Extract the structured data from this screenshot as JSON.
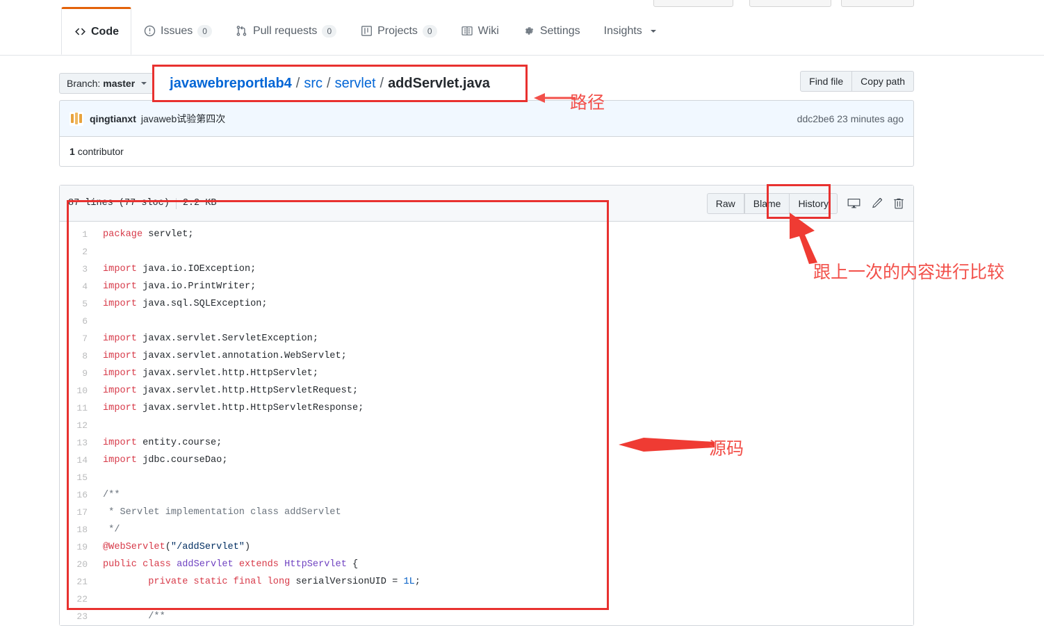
{
  "nav": {
    "tabs": [
      {
        "label": "Code",
        "icon": "code-icon",
        "count": null,
        "active": true
      },
      {
        "label": "Issues",
        "icon": "issue-icon",
        "count": "0",
        "active": false
      },
      {
        "label": "Pull requests",
        "icon": "pull-request-icon",
        "count": "0",
        "active": false
      },
      {
        "label": "Projects",
        "icon": "project-icon",
        "count": "0",
        "active": false
      },
      {
        "label": "Wiki",
        "icon": "book-icon",
        "count": null,
        "active": false
      },
      {
        "label": "Settings",
        "icon": "gear-icon",
        "count": null,
        "active": false
      },
      {
        "label": "Insights",
        "icon": null,
        "count": null,
        "active": false,
        "caret": true
      }
    ]
  },
  "pathbar": {
    "branch_label": "Branch:",
    "branch_name": "master",
    "breadcrumb": [
      {
        "text": "javawebreportlab4",
        "type": "link-strong"
      },
      {
        "text": "/",
        "type": "sep"
      },
      {
        "text": "src",
        "type": "link"
      },
      {
        "text": "/",
        "type": "sep"
      },
      {
        "text": "servlet",
        "type": "link"
      },
      {
        "text": "/",
        "type": "sep"
      },
      {
        "text": "addServlet.java",
        "type": "current"
      }
    ],
    "find_file": "Find file",
    "copy_path": "Copy path"
  },
  "commit": {
    "author": "qingtianxt",
    "message": "javaweb试验第四次",
    "sha": "ddc2be6",
    "time": "23 minutes ago",
    "contributors": "1",
    "contributors_label": "contributor"
  },
  "blob": {
    "lines_info": "87 lines (77 sloc)",
    "size": "2.2 KB",
    "buttons": [
      "Raw",
      "Blame",
      "History"
    ],
    "icons": [
      "desktop-icon",
      "pencil-icon",
      "trash-icon"
    ]
  },
  "code": {
    "lines": [
      {
        "n": "1",
        "tokens": [
          {
            "t": "package",
            "c": "k"
          },
          {
            "t": " servlet;",
            "c": ""
          }
        ]
      },
      {
        "n": "2",
        "tokens": []
      },
      {
        "n": "3",
        "tokens": [
          {
            "t": "import",
            "c": "k"
          },
          {
            "t": " java.io.IOException;",
            "c": ""
          }
        ]
      },
      {
        "n": "4",
        "tokens": [
          {
            "t": "import",
            "c": "k"
          },
          {
            "t": " java.io.PrintWriter;",
            "c": ""
          }
        ]
      },
      {
        "n": "5",
        "tokens": [
          {
            "t": "import",
            "c": "k"
          },
          {
            "t": " java.sql.SQLException;",
            "c": ""
          }
        ]
      },
      {
        "n": "6",
        "tokens": []
      },
      {
        "n": "7",
        "tokens": [
          {
            "t": "import",
            "c": "k"
          },
          {
            "t": " javax.servlet.ServletException;",
            "c": ""
          }
        ]
      },
      {
        "n": "8",
        "tokens": [
          {
            "t": "import",
            "c": "k"
          },
          {
            "t": " javax.servlet.annotation.WebServlet;",
            "c": ""
          }
        ]
      },
      {
        "n": "9",
        "tokens": [
          {
            "t": "import",
            "c": "k"
          },
          {
            "t": " javax.servlet.http.HttpServlet;",
            "c": ""
          }
        ]
      },
      {
        "n": "10",
        "tokens": [
          {
            "t": "import",
            "c": "k"
          },
          {
            "t": " javax.servlet.http.HttpServletRequest;",
            "c": ""
          }
        ]
      },
      {
        "n": "11",
        "tokens": [
          {
            "t": "import",
            "c": "k"
          },
          {
            "t": " javax.servlet.http.HttpServletResponse;",
            "c": ""
          }
        ]
      },
      {
        "n": "12",
        "tokens": []
      },
      {
        "n": "13",
        "tokens": [
          {
            "t": "import",
            "c": "k"
          },
          {
            "t": " entity.course;",
            "c": ""
          }
        ]
      },
      {
        "n": "14",
        "tokens": [
          {
            "t": "import",
            "c": "k"
          },
          {
            "t": " jdbc.courseDao;",
            "c": ""
          }
        ]
      },
      {
        "n": "15",
        "tokens": []
      },
      {
        "n": "16",
        "tokens": [
          {
            "t": "/**",
            "c": "cm"
          }
        ]
      },
      {
        "n": "17",
        "tokens": [
          {
            "t": " * Servlet implementation class addServlet",
            "c": "cm"
          }
        ]
      },
      {
        "n": "18",
        "tokens": [
          {
            "t": " */",
            "c": "cm"
          }
        ]
      },
      {
        "n": "19",
        "tokens": [
          {
            "t": "@WebServlet",
            "c": "an"
          },
          {
            "t": "(",
            "c": ""
          },
          {
            "t": "\"/addServlet\"",
            "c": "s"
          },
          {
            "t": ")",
            "c": ""
          }
        ]
      },
      {
        "n": "20",
        "tokens": [
          {
            "t": "public",
            "c": "k"
          },
          {
            "t": " ",
            "c": ""
          },
          {
            "t": "class",
            "c": "k"
          },
          {
            "t": " ",
            "c": ""
          },
          {
            "t": "addServlet",
            "c": "t"
          },
          {
            "t": " ",
            "c": ""
          },
          {
            "t": "extends",
            "c": "k"
          },
          {
            "t": " ",
            "c": ""
          },
          {
            "t": "HttpServlet",
            "c": "t"
          },
          {
            "t": " {",
            "c": ""
          }
        ]
      },
      {
        "n": "21",
        "tokens": [
          {
            "t": "        ",
            "c": ""
          },
          {
            "t": "private",
            "c": "k"
          },
          {
            "t": " ",
            "c": ""
          },
          {
            "t": "static",
            "c": "k"
          },
          {
            "t": " ",
            "c": ""
          },
          {
            "t": "final",
            "c": "k"
          },
          {
            "t": " ",
            "c": ""
          },
          {
            "t": "long",
            "c": "k"
          },
          {
            "t": " serialVersionUID = ",
            "c": ""
          },
          {
            "t": "1L",
            "c": "n"
          },
          {
            "t": ";",
            "c": ""
          }
        ]
      },
      {
        "n": "22",
        "tokens": []
      },
      {
        "n": "23",
        "tokens": [
          {
            "t": "        /**",
            "c": "cm"
          }
        ]
      }
    ]
  },
  "annotations": {
    "path_label": "路径",
    "source_label": "源码",
    "compare_label": "跟上一次的内容进行比较",
    "box_color": "#e8312f",
    "text_color": "#f2504a"
  }
}
